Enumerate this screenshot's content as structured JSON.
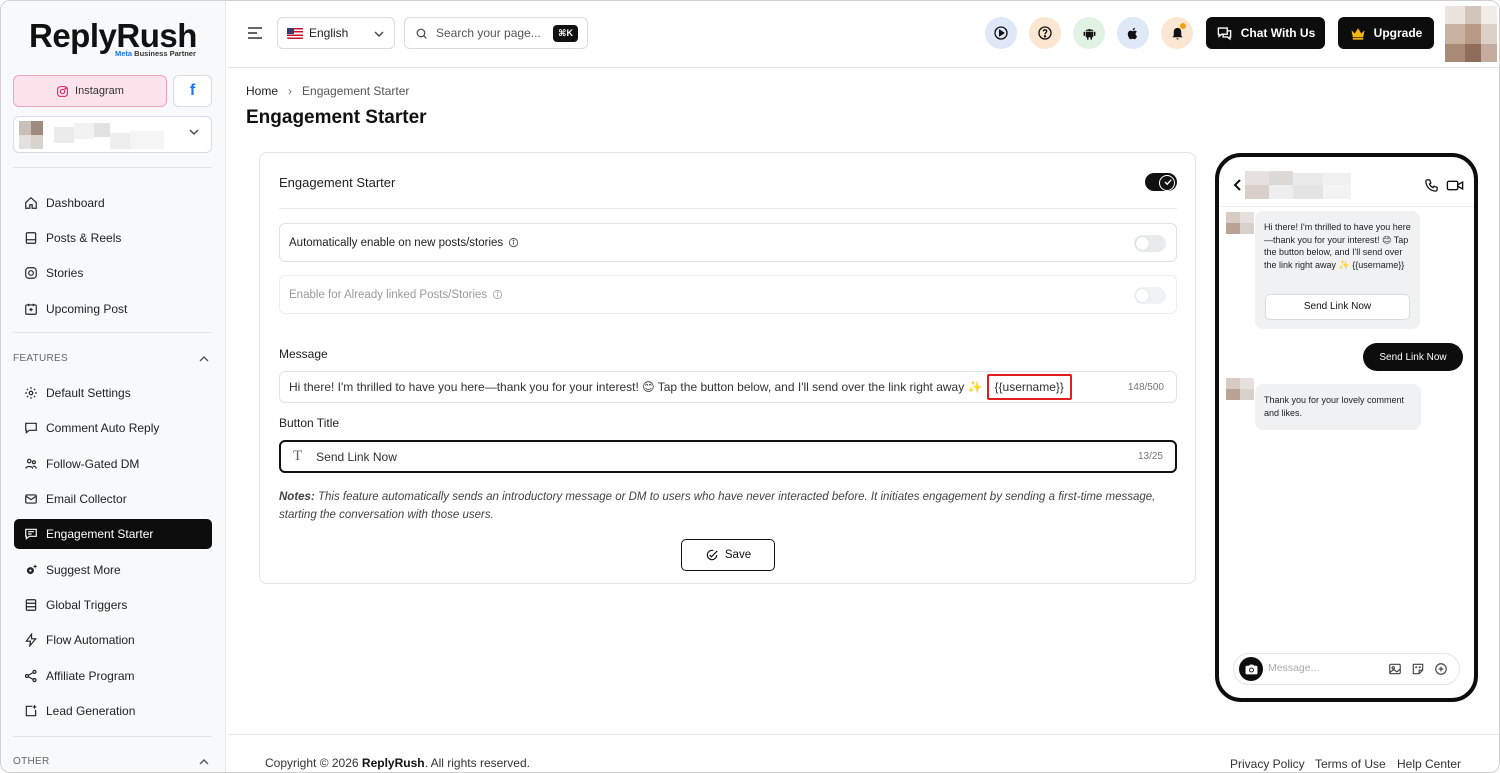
{
  "app": {
    "logo": "ReplyRush",
    "logo_sub_brand": "Meta",
    "logo_sub_text": " Business Partner"
  },
  "sidebar": {
    "instagram_label": "Instagram",
    "fb_label": "f",
    "main_items": [
      {
        "label": "Dashboard",
        "icon": "home-icon"
      },
      {
        "label": "Posts & Reels",
        "icon": "posts-icon"
      },
      {
        "label": "Stories",
        "icon": "stories-icon"
      },
      {
        "label": "Upcoming Post",
        "icon": "calendar-icon"
      }
    ],
    "features_label": "FEATURES",
    "feature_items": [
      {
        "label": "Default Settings",
        "icon": "gear-icon"
      },
      {
        "label": "Comment Auto Reply",
        "icon": "comment-icon"
      },
      {
        "label": "Follow-Gated DM",
        "icon": "users-icon"
      },
      {
        "label": "Email Collector",
        "icon": "mail-icon"
      },
      {
        "label": "Engagement Starter",
        "icon": "chat-icon",
        "active": true
      },
      {
        "label": "Suggest More",
        "icon": "cog-sparkle-icon"
      },
      {
        "label": "Global Triggers",
        "icon": "list-icon"
      },
      {
        "label": "Flow Automation",
        "icon": "bolt-icon"
      },
      {
        "label": "Affiliate Program",
        "icon": "share-icon"
      },
      {
        "label": "Lead Generation",
        "icon": "lead-icon"
      }
    ],
    "other_label": "OTHER"
  },
  "header": {
    "language": "English",
    "search_placeholder": "Search your page...",
    "search_shortcut": "⌘K",
    "chat_label": "Chat With Us",
    "upgrade_label": "Upgrade"
  },
  "breadcrumb": {
    "home": "Home",
    "separator": "›",
    "current": "Engagement Starter"
  },
  "page": {
    "title": "Engagement Starter",
    "card_title": "Engagement Starter",
    "main_toggle_on": true,
    "auto_enable_label": "Automatically enable on new posts/stories",
    "linked_label": "Enable for Already linked Posts/Stories",
    "message_label": "Message",
    "message_text": "Hi there! I'm thrilled to have you here—thank you for your interest! 😊 Tap the button below, and I'll send over the link right away ✨",
    "message_variable": "{{username}}",
    "message_count": "148/500",
    "button_title_label": "Button Title",
    "button_title_value": "Send Link Now",
    "button_title_count": "13/25",
    "notes_label": "Notes:",
    "notes_text": " This feature automatically sends an introductory message or DM to users who have never interacted before. It initiates engagement by sending a first-time message, starting the conversation with those users.",
    "save_label": "Save"
  },
  "preview": {
    "incoming_message": "Hi there! I'm thrilled to have you here—thank you for your interest! 😊 Tap the button below, and I'll send over the link right away ✨ {{username}}",
    "button_label": "Send Link Now",
    "sent_message": "Send Link Now",
    "reply_message": "Thank you for your lovely comment and likes.",
    "input_placeholder": "Message..."
  },
  "footer": {
    "copyright_prefix": "Copyright © 2026 ",
    "copyright_brand": "ReplyRush",
    "copyright_suffix": ". All rights reserved.",
    "privacy": "Privacy Policy",
    "terms": "Terms of Use",
    "help": "Help Center"
  },
  "colors": {
    "accent": "#0d0d0d",
    "instagram_bg": "#fde4ec",
    "facebook": "#1877f2",
    "highlight": "#e11d1d"
  }
}
